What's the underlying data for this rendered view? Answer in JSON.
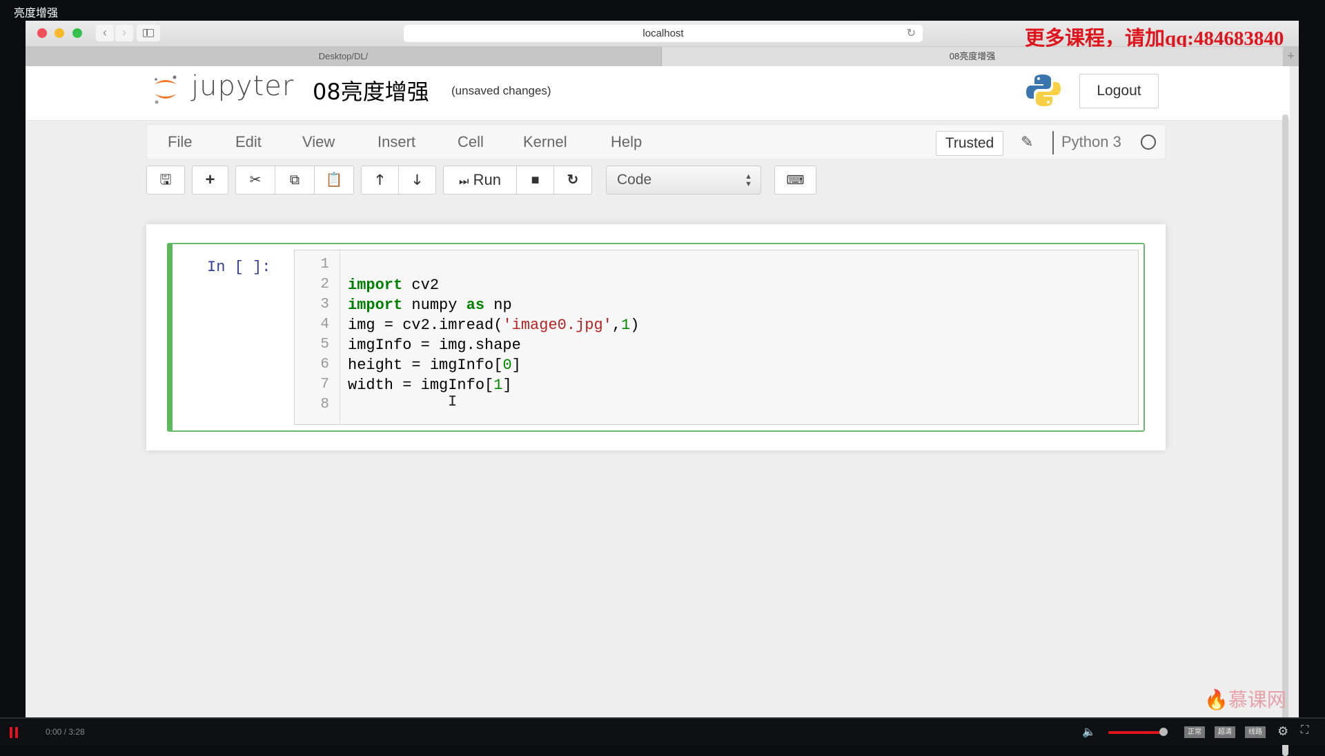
{
  "video": {
    "title": "亮度增强",
    "time": "0:00 / 3:28",
    "volume_percent": 100,
    "quality_buttons": [
      "正常",
      "超清",
      "线路"
    ],
    "watermark": "更多课程，请加qq:484683840",
    "site_logo": "慕课网"
  },
  "browser": {
    "url": "localhost",
    "tabs": [
      {
        "label": "Desktop/DL/",
        "active": false
      },
      {
        "label": "08亮度增强",
        "active": true
      }
    ],
    "new_tab": "+"
  },
  "jupyter": {
    "logo_text": "jupyter",
    "notebook_title": "08亮度增强",
    "save_status": "(unsaved changes)",
    "logout_label": "Logout",
    "menu": [
      "File",
      "Edit",
      "View",
      "Insert",
      "Cell",
      "Kernel",
      "Help"
    ],
    "trusted_label": "Trusted",
    "kernel_name": "Python 3",
    "toolbar": {
      "run_label": "Run",
      "cell_type": "Code",
      "icons": [
        "save-icon",
        "plus-icon",
        "cut-icon",
        "copy-icon",
        "paste-icon",
        "arrow-up-icon",
        "arrow-down-icon",
        "run-icon",
        "stop-icon",
        "restart-icon",
        "keyboard-icon"
      ]
    },
    "cell": {
      "prompt": "In [ ]:",
      "line_numbers": [
        "1",
        "2",
        "3",
        "4",
        "5",
        "6",
        "7",
        "8"
      ],
      "lines": [
        [],
        [
          {
            "t": "import",
            "c": "kw"
          },
          {
            "t": " cv2",
            "c": ""
          }
        ],
        [
          {
            "t": "import",
            "c": "kw"
          },
          {
            "t": " numpy ",
            "c": ""
          },
          {
            "t": "as",
            "c": "kw"
          },
          {
            "t": " np",
            "c": ""
          }
        ],
        [
          {
            "t": "img = cv2.imread(",
            "c": ""
          },
          {
            "t": "'image0.jpg'",
            "c": "str"
          },
          {
            "t": ",",
            "c": ""
          },
          {
            "t": "1",
            "c": "num"
          },
          {
            "t": ")",
            "c": ""
          }
        ],
        [
          {
            "t": "imgInfo = img.shape",
            "c": ""
          }
        ],
        [
          {
            "t": "height = imgInfo[",
            "c": ""
          },
          {
            "t": "0",
            "c": "num"
          },
          {
            "t": "]",
            "c": ""
          }
        ],
        [
          {
            "t": "width = imgInfo[",
            "c": ""
          },
          {
            "t": "1",
            "c": "num"
          },
          {
            "t": "]",
            "c": ""
          }
        ],
        []
      ]
    }
  }
}
